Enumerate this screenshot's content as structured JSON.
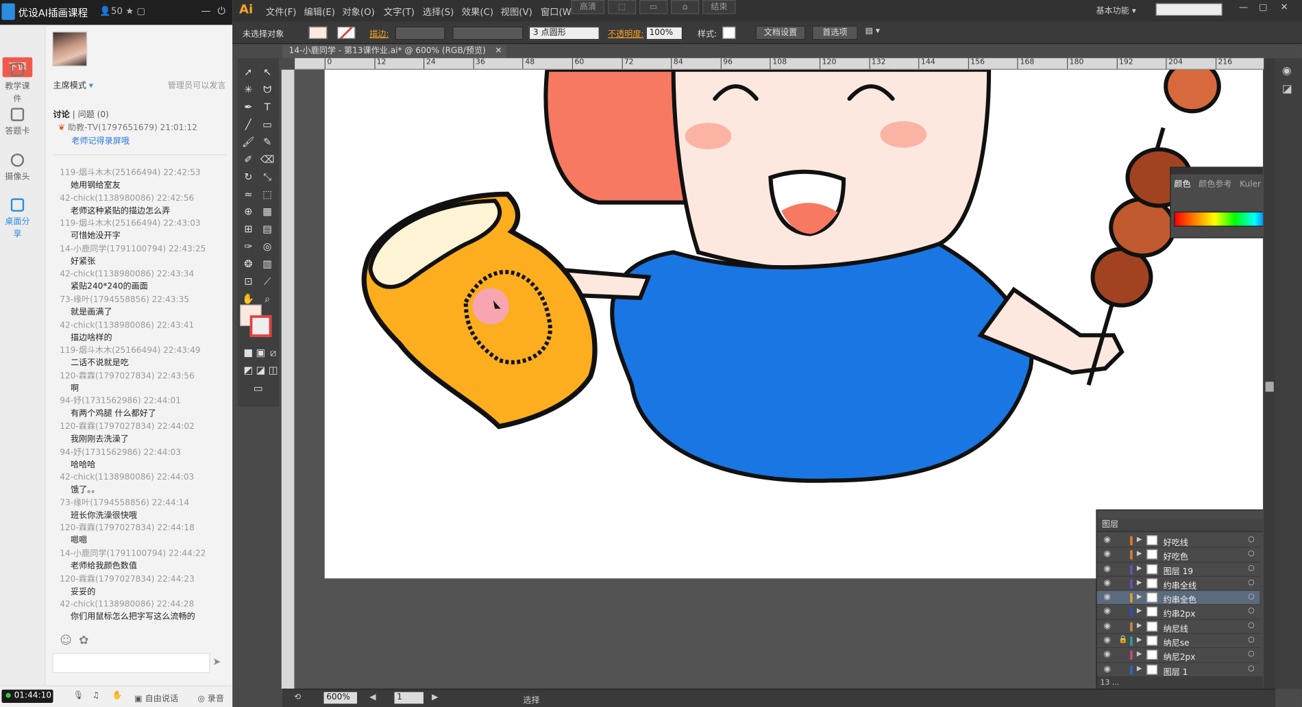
{
  "chat": {
    "title": "优设AI插画课程",
    "count": "50",
    "leave_button": "下课",
    "rail": [
      "教学课件",
      "答题卡",
      "摄像头",
      "桌面分享"
    ],
    "mode": "主席模式",
    "admin_note": "管理员可以发言",
    "tabs": {
      "discuss": "讨论",
      "questions": "问题",
      "question_count": "(0)"
    },
    "pinned": {
      "header": "助教-TV(1797651679) 21:01:12",
      "text": "老师记得录屏哦"
    },
    "messages": [
      {
        "h": "119-烟斗木木(25166494) 22:42:53",
        "t": "她用钢给室友"
      },
      {
        "h": "42-chick(1138980086) 22:42:56",
        "t": "老师这种紧贴的描边怎么弄"
      },
      {
        "h": "119-烟斗木木(25166494) 22:43:03",
        "t": "可惜她没开字"
      },
      {
        "h": "14-小鹿同学(1791100794) 22:43:25",
        "t": "好紧张"
      },
      {
        "h": "42-chick(1138980086) 22:43:34",
        "t": "紧贴240*240的画面"
      },
      {
        "h": "73-缘叶(1794558856) 22:43:35",
        "t": "就是画满了"
      },
      {
        "h": "42-chick(1138980086) 22:43:41",
        "t": "描边啥样的"
      },
      {
        "h": "119-烟斗木木(25166494) 22:43:49",
        "t": "二话不说就是吃"
      },
      {
        "h": "120-霖霖(1797027834) 22:43:56",
        "t": "啊"
      },
      {
        "h": "94-妤(1731562986) 22:44:01",
        "t": "有两个鸡腿 什么都好了"
      },
      {
        "h": "120-霖霖(1797027834) 22:44:02",
        "t": "我刚刚去洗澡了"
      },
      {
        "h": "94-妤(1731562986) 22:44:03",
        "t": "哈哈哈"
      },
      {
        "h": "42-chick(1138980086) 22:44:03",
        "t": "饿了。。"
      },
      {
        "h": "73-缘叶(1794558856) 22:44:14",
        "t": "班长你洗澡很快哦"
      },
      {
        "h": "120-霖霖(1797027834) 22:44:18",
        "t": "嗯嗯"
      },
      {
        "h": "14-小鹿同学(1791100794) 22:44:22",
        "t": "老师给我颜色数值"
      },
      {
        "h": "120-霖霖(1797027834) 22:44:23",
        "t": "妥妥的"
      },
      {
        "h": "42-chick(1138980086) 22:44:28",
        "t": "你们用鼠标怎么把字写这么流畅的"
      }
    ],
    "bottom": {
      "timer": "01:44:10",
      "free_talk": "自由说话",
      "record": "录音"
    }
  },
  "ai": {
    "logo": "Ai",
    "menus": [
      "文件(F)",
      "编辑(E)",
      "对象(O)",
      "文字(T)",
      "选择(S)",
      "效果(C)",
      "视图(V)",
      "窗口(W"
    ],
    "top_buttons": [
      "高清",
      "",
      "",
      "",
      "结束"
    ],
    "workspace": "基本功能",
    "control": {
      "no_selection": "未选择对象",
      "stroke_label": "描边:",
      "brush": "3 点圆形",
      "opacity_label": "不透明度:",
      "opacity_value": "100%",
      "style_label": "样式:",
      "doc_setup": "文档设置",
      "prefs": "首选项"
    },
    "doc_tab": "14-小鹿同学 - 第13课作业.ai* @ 600% (RGB/预览)",
    "ruler": [
      "0",
      "12",
      "24",
      "36",
      "48",
      "60",
      "72",
      "84",
      "96",
      "108",
      "120",
      "132",
      "144",
      "156",
      "168",
      "180",
      "192",
      "204",
      "216"
    ],
    "color_panel": {
      "tabs": [
        "颜色",
        "颜色参考",
        "Kuler"
      ],
      "hex": "fce5dc"
    },
    "layers_panel": {
      "title": "图层",
      "count": "13 ...",
      "layers": [
        {
          "name": "好吃线",
          "color": "#e07a2a",
          "selected": false,
          "locked": false
        },
        {
          "name": "好吃色",
          "color": "#e07a2a",
          "selected": false,
          "locked": false
        },
        {
          "name": "图层 19",
          "color": "#6a4fc0",
          "selected": false,
          "locked": false
        },
        {
          "name": "约串全线",
          "color": "#6a4fc0",
          "selected": false,
          "locked": false
        },
        {
          "name": "约串全色",
          "color": "#e0a02a",
          "selected": true,
          "locked": false
        },
        {
          "name": "约串2px",
          "color": "#2a4fc0",
          "selected": false,
          "locked": false
        },
        {
          "name": "纳尼线",
          "color": "#c08a4a",
          "selected": false,
          "locked": false
        },
        {
          "name": "纳尼se",
          "color": "#2aa09a",
          "selected": false,
          "locked": true
        },
        {
          "name": "纳尼2px",
          "color": "#c04a7a",
          "selected": false,
          "locked": false
        },
        {
          "name": "图层 1",
          "color": "#2a6ac0",
          "selected": false,
          "locked": false
        }
      ]
    },
    "status": {
      "zoom": "600%",
      "page": "1",
      "mode": "选择"
    }
  }
}
